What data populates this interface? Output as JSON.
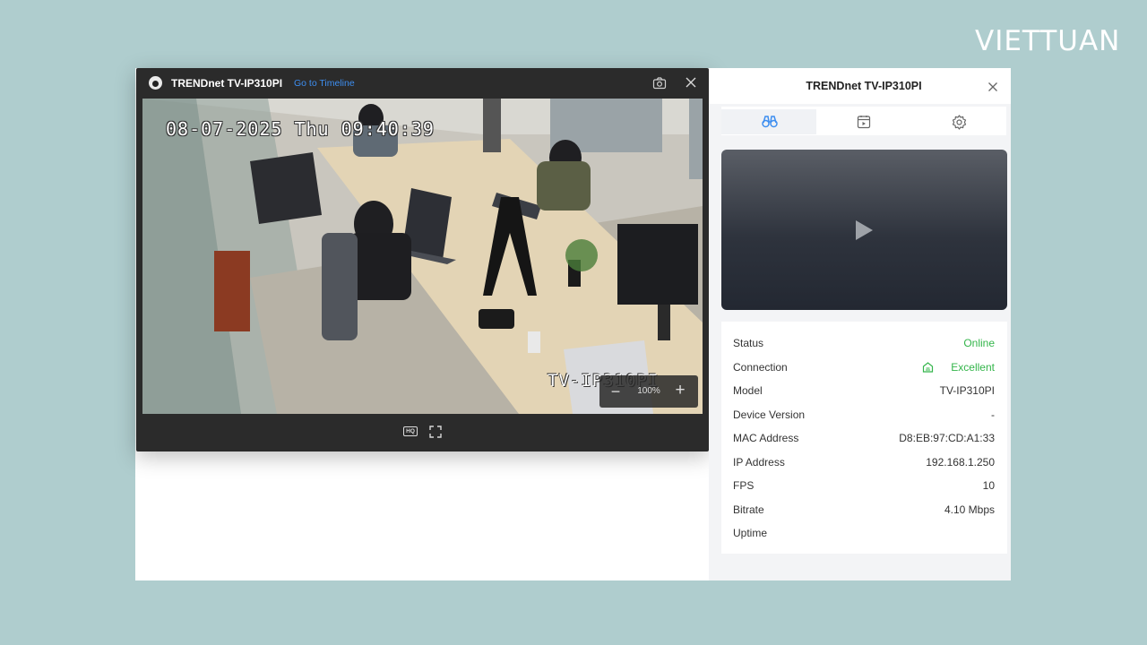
{
  "brand": {
    "name": "VIETTUAN"
  },
  "video_window": {
    "title": "TRENDnet TV-IP310PI",
    "timeline_link": "Go to Timeline",
    "snapshot_icon": "camera-snapshot-icon",
    "close_icon": "close-icon",
    "osd_datetime": "08-07-2025 Thu 09:40:39",
    "osd_camera_name": "TV-IP310PI",
    "zoom": {
      "level": "100%",
      "minus": "−",
      "plus": "+"
    },
    "hq_label": "HQ",
    "fullscreen_icon": "fullscreen-icon"
  },
  "panel": {
    "title": "TRENDnet TV-IP310PI",
    "tabs": [
      {
        "icon": "binoculars-icon",
        "active": true
      },
      {
        "icon": "playback-calendar-icon",
        "active": false
      },
      {
        "icon": "gear-icon",
        "active": false
      }
    ],
    "info": [
      {
        "label": "Status",
        "value": "Online",
        "color": "#33b54a"
      },
      {
        "label": "Connection",
        "value": "Excellent",
        "color": "#33b54a",
        "icon": "signal-icon"
      },
      {
        "label": "Model",
        "value": "TV-IP310PI"
      },
      {
        "label": "Device Version",
        "value": "-"
      },
      {
        "label": "MAC Address",
        "value": "D8:EB:97:CD:A1:33"
      },
      {
        "label": "IP Address",
        "value": "192.168.1.250"
      },
      {
        "label": "FPS",
        "value": "10"
      },
      {
        "label": "Bitrate",
        "value": "4.10 Mbps"
      },
      {
        "label": "Uptime",
        "value": ""
      }
    ]
  },
  "colors": {
    "background": "#afcdce",
    "accent_link": "#3d8ef0",
    "status_green": "#33b54a"
  }
}
